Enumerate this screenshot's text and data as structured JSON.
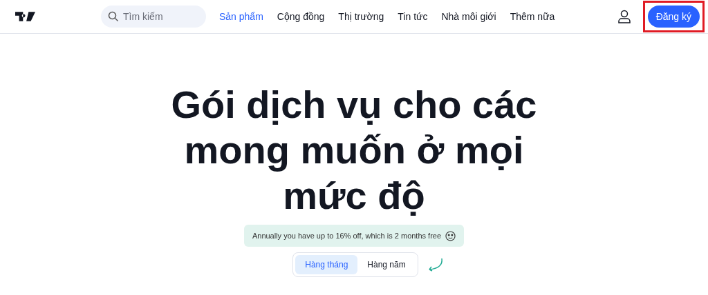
{
  "header": {
    "search": {
      "placeholder": "Tìm kiếm"
    },
    "nav": [
      {
        "label": "Sản phẩm",
        "selected": true
      },
      {
        "label": "Cộng đồng",
        "selected": false
      },
      {
        "label": "Thị trường",
        "selected": false
      },
      {
        "label": "Tin tức",
        "selected": false
      },
      {
        "label": "Nhà môi giới",
        "selected": false
      },
      {
        "label": "Thêm nữa",
        "selected": false
      }
    ],
    "signup_button": "Đăng ký"
  },
  "hero": {
    "title_lines": [
      "Gói dịch vụ cho các",
      "mong muốn ở mọi",
      "mức độ"
    ],
    "banner": "Annually you have up to 16% off, which is 2 months free",
    "billing_tabs": [
      {
        "label": "Hàng tháng",
        "selected": true
      },
      {
        "label": "Hàng năm",
        "selected": false
      }
    ]
  }
}
